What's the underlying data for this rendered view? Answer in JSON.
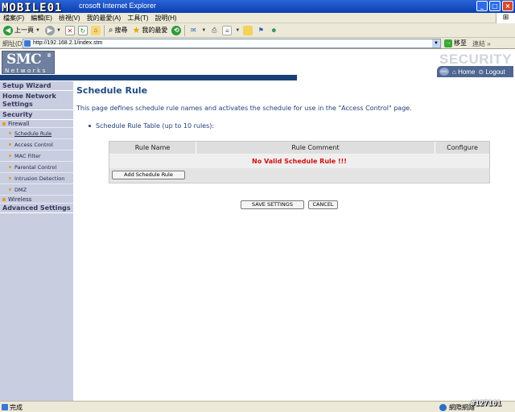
{
  "browser": {
    "title": "crosoft Internet Explorer",
    "watermark_logo": "MOBILE01",
    "window_buttons": [
      "_",
      "□",
      "×"
    ],
    "menu": [
      "檔案(F)",
      "編輯(E)",
      "檢視(V)",
      "我的最愛(A)",
      "工具(T)",
      "說明(H)"
    ],
    "toolbar": {
      "back_label": "上一頁",
      "search_label": "搜尋",
      "favorites_label": "我的最愛"
    },
    "address": {
      "label": "網址(D)",
      "url": "http://192.168.2.1/index.stm",
      "go_label": "移至",
      "links_label": "連結 »"
    },
    "status": {
      "text": "完成",
      "zone": "網際網路"
    },
    "watermark_id": "#127101"
  },
  "header": {
    "brand": "SMC",
    "brand_reg": "®",
    "brand_sub": "Networks",
    "section_word": "SECURITY",
    "nav_home": "Home",
    "nav_logout": "Logout"
  },
  "sidebar": {
    "setup_wizard": "Setup Wizard",
    "home_network_settings": "Home Network Settings",
    "security": "Security",
    "firewall": "Firewall",
    "firewall_items": [
      "Schedule Rule",
      "Access Control",
      "MAC Filter",
      "Parental Control",
      "Intrusion Detection",
      "DMZ"
    ],
    "wireless": "Wireless",
    "advanced_settings": "Advanced Settings"
  },
  "content": {
    "title": "Schedule Rule",
    "description": "This page defines schedule rule names and activates the schedule for use in the \"Access Control\" page.",
    "bullet": "Schedule Rule Table (up to 10 rules):",
    "table": {
      "columns": [
        "Rule Name",
        "Rule Comment",
        "Configure"
      ],
      "empty_message": "No Valid Schedule Rule !!!",
      "add_button": "Add Schedule Rule"
    },
    "save_button": "SAVE SETTINGS",
    "cancel_button": "CANCEL"
  }
}
